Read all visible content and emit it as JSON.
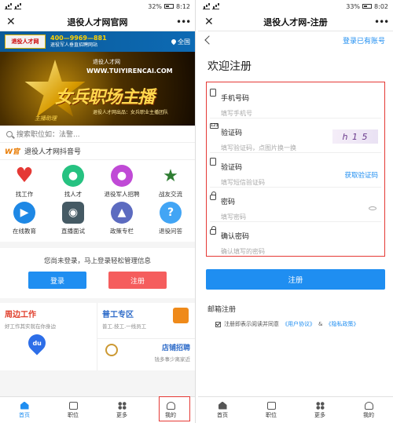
{
  "left": {
    "status": {
      "time": "8:12",
      "battery": "32%"
    },
    "nav": {
      "close": "✕",
      "title": "退役人才网官网",
      "more": "•••"
    },
    "banner": {
      "logo": "退役人才网",
      "phone": "400—9969—881",
      "slogan": "退役军人垂直招聘网站",
      "region": "全国"
    },
    "hero": {
      "url": "WWW.TUIYIRENCAI.COM",
      "title": "女兵职场主播",
      "small": "退役人才网",
      "subtitle": "退役人才网出品：女兵职业主播团队",
      "mark": "主播助理"
    },
    "search": {
      "placeholder": "搜索职位如：法警..."
    },
    "official": {
      "logo": "W官",
      "text": "退役人才网抖音号"
    },
    "grid": [
      {
        "label": "找工作",
        "icon": "heart-icon",
        "color": "#e53935",
        "glyph": "♥"
      },
      {
        "label": "找人才",
        "icon": "person-icon",
        "color": "#26c281",
        "glyph": "●"
      },
      {
        "label": "退役军人招聘",
        "icon": "drop-icon",
        "color": "#c04ad6",
        "glyph": "●"
      },
      {
        "label": "战友交流",
        "icon": "star-badge-icon",
        "color": "#2e7d32",
        "glyph": "★"
      },
      {
        "label": "在线教育",
        "icon": "play-icon",
        "color": "#1e88e5",
        "glyph": "▶"
      },
      {
        "label": "直播面试",
        "icon": "camera-icon",
        "color": "#455a64",
        "glyph": "◉"
      },
      {
        "label": "政策专栏",
        "icon": "shirt-icon",
        "color": "#5c6bc0",
        "glyph": "▲"
      },
      {
        "label": "退役问答",
        "icon": "question-icon",
        "color": "#42a5f5",
        "glyph": "?"
      }
    ],
    "login_panel": {
      "message": "您尚未登录，马上登录轻松管理信息",
      "login": "登录",
      "register": "注册"
    },
    "cards": {
      "nearby_title": "周边工作",
      "nearby_sub": "好工作其实就在你身边",
      "general_title": "普工专区",
      "general_sub": "普工.技工.一线员工",
      "du_label": "du",
      "shop_title": "店铺招聘",
      "shop_sub": "钱多事少离家近"
    },
    "tabs": [
      "首页",
      "职位",
      "更多",
      "我的"
    ]
  },
  "right": {
    "status": {
      "time": "8:02",
      "battery": "33%"
    },
    "nav": {
      "close": "✕",
      "title": "退役人才网-注册",
      "more": "•••"
    },
    "login_link": "登录已有账号",
    "welcome": "欢迎注册",
    "fields": {
      "phone_label": "手机号码",
      "phone_placeholder": "填写手机号",
      "code_label": "验证码",
      "code_placeholder": "填写验证码，点图片换一换",
      "captcha": "h 1 5",
      "sms_label": "验证码",
      "sms_placeholder": "填写短信验证码",
      "sms_btn": "获取验证码",
      "pwd_label": "密码",
      "pwd_placeholder": "填写密码",
      "pwd2_label": "确认密码",
      "pwd2_placeholder": "确认填写的密码"
    },
    "submit": "注册",
    "email_reg": "邮箱注册",
    "agree": {
      "prefix": "注册即表示阅读并同意",
      "terms": "《用户协议》",
      "and": "&",
      "privacy": "《隐私政策》"
    },
    "tabs": [
      "首页",
      "职位",
      "更多",
      "我的"
    ]
  }
}
